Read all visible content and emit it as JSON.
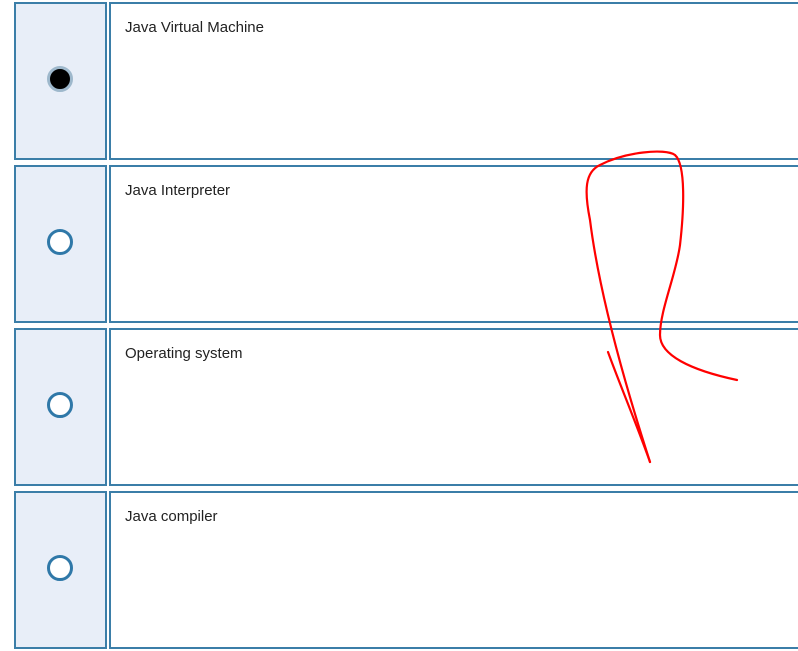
{
  "question": {
    "options": [
      {
        "label": "Java Virtual Machine",
        "selected": true
      },
      {
        "label": "Java Interpreter",
        "selected": false
      },
      {
        "label": "Operating system",
        "selected": false
      },
      {
        "label": "Java compiler",
        "selected": false
      }
    ]
  },
  "colors": {
    "border": "#3b7ea8",
    "radio_cell_bg": "#e8eef8",
    "radio_ring": "#2f78a8",
    "annotation_stroke": "#ff0000"
  }
}
